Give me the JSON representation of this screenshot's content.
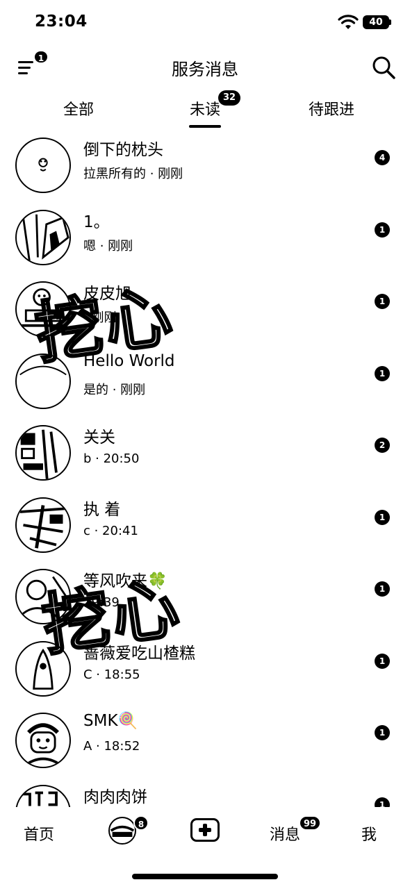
{
  "status_bar": {
    "time": "23:04",
    "battery": "40"
  },
  "header": {
    "title": "服务消息",
    "menu_badge": "1",
    "menu_icon": "menu-icon",
    "search_icon": "search-icon"
  },
  "tabs": [
    {
      "label": "全部"
    },
    {
      "label": "未读",
      "badge": "32",
      "active": true
    },
    {
      "label": "待跟进"
    }
  ],
  "messages": [
    {
      "name": "倒下的枕头",
      "subtitle": "拉黑所有的 · 刚刚",
      "unread": "4"
    },
    {
      "name": "1。",
      "subtitle": "嗯 · 刚刚",
      "unread": "1"
    },
    {
      "name": "皮皮旭",
      "subtitle": "· 刚刚",
      "unread": "1"
    },
    {
      "name": "Hello World",
      "subtitle": "是的 · 刚刚",
      "unread": "1"
    },
    {
      "name": "关关",
      "subtitle": "b · 20:50",
      "unread": "2"
    },
    {
      "name": "执 着",
      "subtitle": "c · 20:41",
      "unread": "1"
    },
    {
      "name": "等风吹来🍀",
      "subtitle": "19:39",
      "unread": "1"
    },
    {
      "name": "蔷薇爱吃山楂糕",
      "subtitle": "C · 18:55",
      "unread": "1"
    },
    {
      "name": "SMK🍭",
      "subtitle": "A · 18:52",
      "unread": "1"
    },
    {
      "name": "肉肉肉饼",
      "subtitle": "",
      "unread": "1"
    }
  ],
  "watermark": "挖心",
  "bottom_nav": {
    "home": "首页",
    "avatar_badge": "8",
    "messages": "消息",
    "messages_badge": "99",
    "me": "我"
  }
}
